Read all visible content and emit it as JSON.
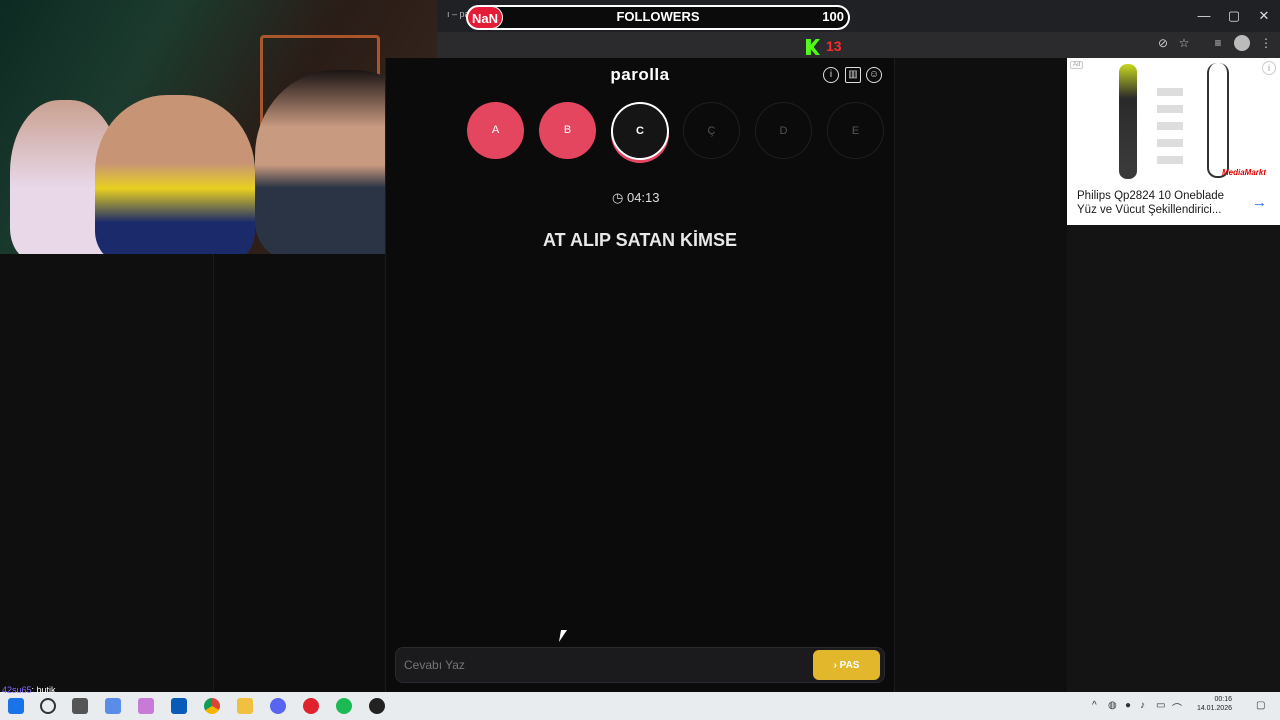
{
  "browser": {
    "tab_fragment": "ı – parol",
    "window_controls": [
      "—",
      "▢",
      "✕"
    ]
  },
  "overlay": {
    "nan_badge": "NaN",
    "followers_label": "FOLLOWERS",
    "followers_count": "100",
    "kick_count": "13",
    "kick_color": "#53fc18"
  },
  "app": {
    "title": "parolla",
    "header_icons": [
      "info-icon",
      "stats-icon",
      "profile-icon"
    ],
    "letters": [
      {
        "label": "A",
        "state": "done"
      },
      {
        "label": "B",
        "state": "done"
      },
      {
        "label": "C",
        "state": "active"
      },
      {
        "label": "Ç",
        "state": "todo"
      },
      {
        "label": "D",
        "state": "todo"
      },
      {
        "label": "E",
        "state": "todo"
      }
    ],
    "timer": "04:13",
    "question": "AT ALIP SATAN KİMSE",
    "answer_placeholder": "Cevabı Yaz",
    "pass_button": "PAS",
    "accent_color": "#e4455f",
    "pass_color": "#e2b72b"
  },
  "ad": {
    "title": "Philips Qp2824 10 Oneblade Yüz ve Vücut Şekillendirici...",
    "brand": "MediaMarkt"
  },
  "stream": {
    "chat_user": "42su65",
    "chat_text": ": butik"
  },
  "taskbar": {
    "time": "00:16",
    "date": "14.01.2026"
  }
}
